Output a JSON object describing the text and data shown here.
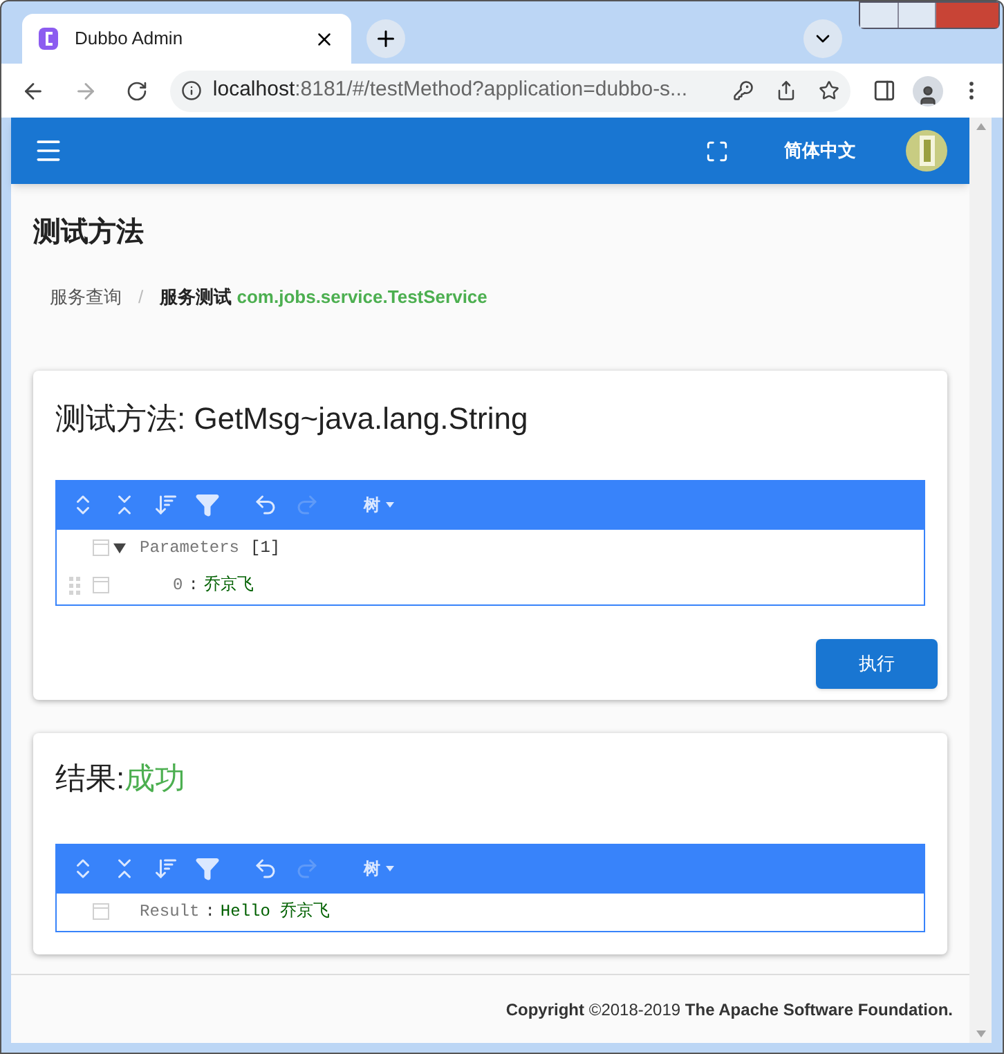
{
  "browser": {
    "tab_title": "Dubbo Admin",
    "address_host": "localhost",
    "address_rest": ":8181/#/testMethod?application=dubbo-s..."
  },
  "app_bar": {
    "language": "简体中文"
  },
  "page_title": "测试方法",
  "breadcrumb_divider": "/",
  "breadcrumbs": [
    {
      "text": "服务查询",
      "active": false
    },
    {
      "text": "服务测试",
      "service": "com.jobs.service.TestService",
      "active": true
    }
  ],
  "method_card": {
    "title": "测试方法: GetMsg~java.lang.String",
    "editor": {
      "mode": "树",
      "nodes": [
        {
          "key": "Parameters",
          "count": "[1]",
          "expanded": true,
          "children": [
            {
              "key": "0",
              "separator": ":",
              "value": "乔京飞"
            }
          ]
        }
      ]
    },
    "button": "执行"
  },
  "result_card": {
    "title": "结果:",
    "status": "成功",
    "success": true,
    "editor": {
      "mode": "树",
      "nodes": [
        {
          "key": "Result",
          "separator": ":",
          "value": "Hello 乔京飞"
        }
      ]
    }
  },
  "footer": {
    "copyright": "**Copyright** ©2018-2019 **The Apache Software Foundation.**"
  }
}
